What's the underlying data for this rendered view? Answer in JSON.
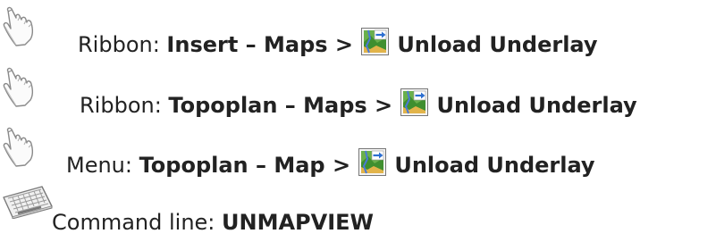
{
  "access_methods": [
    {
      "icon": "mouse-hand-icon",
      "prefix": "Ribbon: ",
      "path": "Insert – Maps >",
      "command_icon": "unload-underlay-icon",
      "command": "Unload Underlay"
    },
    {
      "icon": "mouse-hand-icon",
      "prefix": "Ribbon: ",
      "path": "Topoplan – Maps >",
      "command_icon": "unload-underlay-icon",
      "command": "Unload Underlay"
    },
    {
      "icon": "mouse-hand-icon",
      "prefix": "Menu: ",
      "path": "Topoplan – Map >",
      "command_icon": "unload-underlay-icon",
      "command": "Unload Underlay"
    },
    {
      "icon": "keyboard-icon",
      "prefix": "Command line: ",
      "path": "UNMAPVIEW"
    }
  ]
}
